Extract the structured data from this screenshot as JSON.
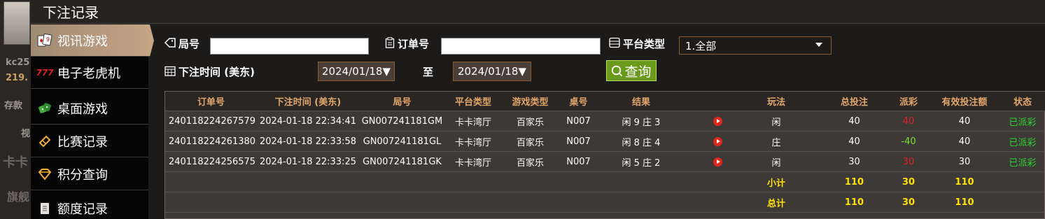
{
  "background": {
    "user_name": "kc25",
    "balance": "219.",
    "deposit": "存款",
    "video": "视",
    "kaka": "卡卡",
    "flagship": "旗舰"
  },
  "title": "下注记录",
  "sidebar": {
    "items": [
      {
        "label": "视讯游戏",
        "icon": "cards-icon",
        "active": true
      },
      {
        "label": "电子老虎机",
        "icon": "slot-777-icon",
        "active": false
      },
      {
        "label": "桌面游戏",
        "icon": "dice-icon",
        "active": false
      },
      {
        "label": "比赛记录",
        "icon": "ticket-icon",
        "active": false
      },
      {
        "label": "积分查询",
        "icon": "diamond-icon",
        "active": false
      },
      {
        "label": "额度记录",
        "icon": "document-icon",
        "active": false
      }
    ]
  },
  "filters": {
    "round_label": "局号",
    "round_value": "",
    "order_label": "订单号",
    "order_value": "",
    "platform_label": "平台类型",
    "platform_value": "1.全部",
    "time_label": "下注时间 (美东)",
    "date_from": "2024/01/18▼",
    "to_label": "至",
    "date_to": "2024/01/18▼",
    "query_label": "查询"
  },
  "table": {
    "headers": [
      "订单号",
      "下注时间 (美东)",
      "局号",
      "平台类型",
      "游戏类型",
      "桌号",
      "结果",
      "",
      "玩法",
      "总投注",
      "派彩",
      "有效投注额",
      "状态"
    ],
    "rows": [
      {
        "order": "240118224267579",
        "time": "2024-01-18 22:34:41",
        "round": "GN007241181GM",
        "platform": "卡卡湾厅",
        "game": "百家乐",
        "table": "N007",
        "result": "闲 9 庄 3",
        "play": "闲",
        "bet": "40",
        "payout": "40",
        "payout_color": "red",
        "valid": "40",
        "status": "已派彩"
      },
      {
        "order": "240118224261380",
        "time": "2024-01-18 22:33:58",
        "round": "GN007241181GL",
        "platform": "卡卡湾厅",
        "game": "百家乐",
        "table": "N007",
        "result": "闲 8 庄 4",
        "play": "庄",
        "bet": "40",
        "payout": "-40",
        "payout_color": "green",
        "valid": "40",
        "status": "已派彩"
      },
      {
        "order": "240118224256575",
        "time": "2024-01-18 22:33:25",
        "round": "GN007241181GK",
        "platform": "卡卡湾厅",
        "game": "百家乐",
        "table": "N007",
        "result": "闲 5 庄 2",
        "play": "闲",
        "bet": "30",
        "payout": "30",
        "payout_color": "red",
        "valid": "30",
        "status": "已派彩"
      }
    ],
    "subtotal": {
      "label": "小计",
      "bet": "110",
      "payout": "30",
      "valid": "110"
    },
    "total": {
      "label": "总计",
      "bet": "110",
      "payout": "30",
      "valid": "110"
    }
  },
  "colors": {
    "header_text": "#e2a56a",
    "positive_payout": "#e02020",
    "negative_payout": "#7ce22a",
    "status_ok": "#2fd12f",
    "totals": "#ffe000",
    "query_button": "#6a9a1c"
  }
}
